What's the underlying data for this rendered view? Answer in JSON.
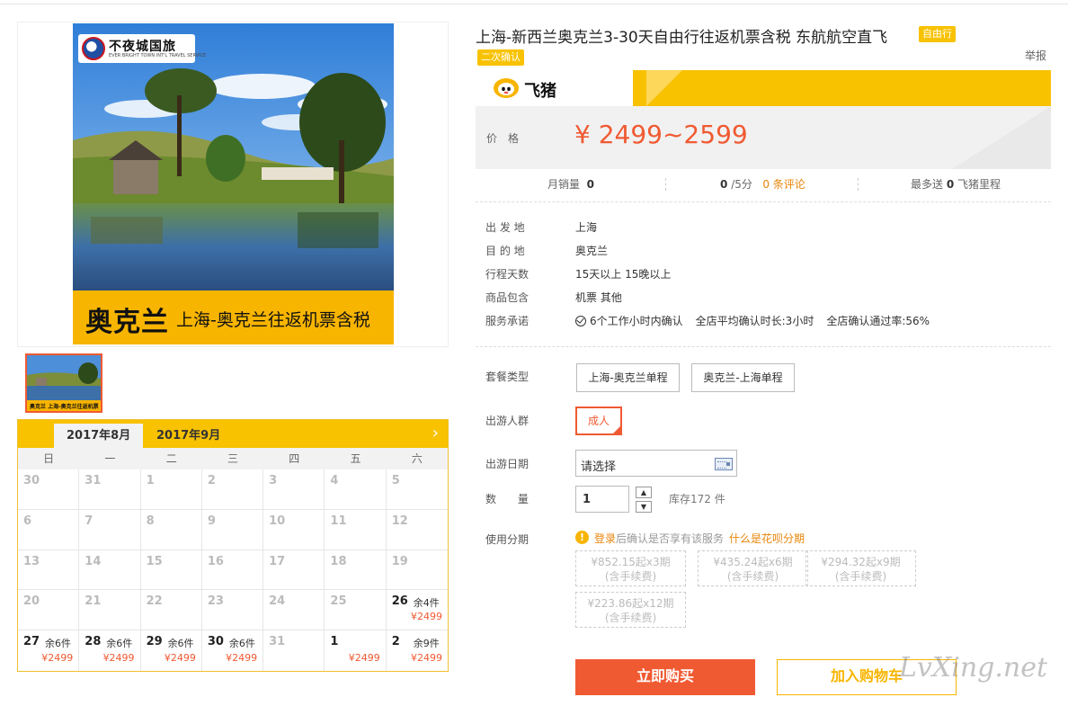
{
  "image": {
    "logo_name": "不夜城国旅",
    "logo_eng": "EVER BRIGHT TOWN INT'L TRAVEL SERVICE",
    "banner_big": "奥克兰",
    "banner_small": "上海-奥克兰往返机票含税",
    "thumb_band": "奥克兰 上海-奥克兰往返机票含税"
  },
  "calendar": {
    "tabs": [
      "2017年8月",
      "2017年9月"
    ],
    "next": "›",
    "weekdays": [
      "日",
      "一",
      "二",
      "三",
      "四",
      "五",
      "六"
    ],
    "cells": [
      {
        "d": "30"
      },
      {
        "d": "31"
      },
      {
        "d": "1"
      },
      {
        "d": "2"
      },
      {
        "d": "3"
      },
      {
        "d": "4"
      },
      {
        "d": "5"
      },
      {
        "d": "6"
      },
      {
        "d": "7"
      },
      {
        "d": "8"
      },
      {
        "d": "9"
      },
      {
        "d": "10"
      },
      {
        "d": "11"
      },
      {
        "d": "12"
      },
      {
        "d": "13"
      },
      {
        "d": "14"
      },
      {
        "d": "15"
      },
      {
        "d": "16"
      },
      {
        "d": "17"
      },
      {
        "d": "18"
      },
      {
        "d": "19"
      },
      {
        "d": "20"
      },
      {
        "d": "21"
      },
      {
        "d": "22"
      },
      {
        "d": "23"
      },
      {
        "d": "24"
      },
      {
        "d": "25"
      },
      {
        "d": "26",
        "stock": "余4件",
        "price": "¥2499"
      },
      {
        "d": "27",
        "stock": "余6件",
        "price": "¥2499"
      },
      {
        "d": "28",
        "stock": "余6件",
        "price": "¥2499"
      },
      {
        "d": "29",
        "stock": "余6件",
        "price": "¥2499"
      },
      {
        "d": "30",
        "stock": "余6件",
        "price": "¥2499"
      },
      {
        "d": "31"
      },
      {
        "d": "1",
        "price": "¥2499"
      },
      {
        "d": "2",
        "stock": "余9件",
        "price": "¥2499"
      }
    ]
  },
  "product": {
    "title": "上海-新西兰奥克兰3-30天自由行往返机票含税 东航航空直飞",
    "tag_free": "自由行",
    "tag_confirm": "二次确认",
    "report": "举报",
    "brand": "飞猪",
    "price_label": "价格",
    "price": "¥ 2499~2599"
  },
  "stats": {
    "monthly_label": "月销量",
    "monthly_value": "0",
    "score_value": "0",
    "score_unit": "/5分",
    "reviews": "0 条评论",
    "mileage_prefix": "最多送",
    "mileage_value": "0",
    "mileage_suffix": "飞猪里程"
  },
  "info": {
    "depart_label": "出 发 地",
    "depart_value": "上海",
    "dest_label": "目 的 地",
    "dest_value": "奥克兰",
    "days_label": "行程天数",
    "days_value": "15天以上 15晚以上",
    "include_label": "商品包含",
    "include_value": "机票 其他",
    "service_label": "服务承诺",
    "service_1": "6个工作小时内确认",
    "service_2": "全店平均确认时长:3小时",
    "service_3": "全店确认通过率:56%"
  },
  "options": {
    "package_label": "套餐类型",
    "package_1": "上海-奥克兰单程",
    "package_2": "奥克兰-上海单程",
    "people_label": "出游人群",
    "people_1": "成人",
    "date_label": "出游日期",
    "date_placeholder": "请选择",
    "qty_label": "数 量",
    "qty_value": "1",
    "stock": "库存172 件",
    "installment_label": "使用分期",
    "login_link": "登录",
    "login_rest": "后确认是否享有该服务",
    "huabei_link": "什么是花呗分期",
    "installments": [
      {
        "line1": "¥852.15起x3期",
        "line2": "(含手续费)"
      },
      {
        "line1": "¥435.24起x6期",
        "line2": "(含手续费)"
      },
      {
        "line1": "¥294.32起x9期",
        "line2": "(含手续费)"
      },
      {
        "line1": "¥223.86起x12期",
        "line2": "(含手续费)"
      }
    ]
  },
  "actions": {
    "buy": "立即购买",
    "cart": "加入购物车"
  },
  "watermark": "LvXing.net"
}
